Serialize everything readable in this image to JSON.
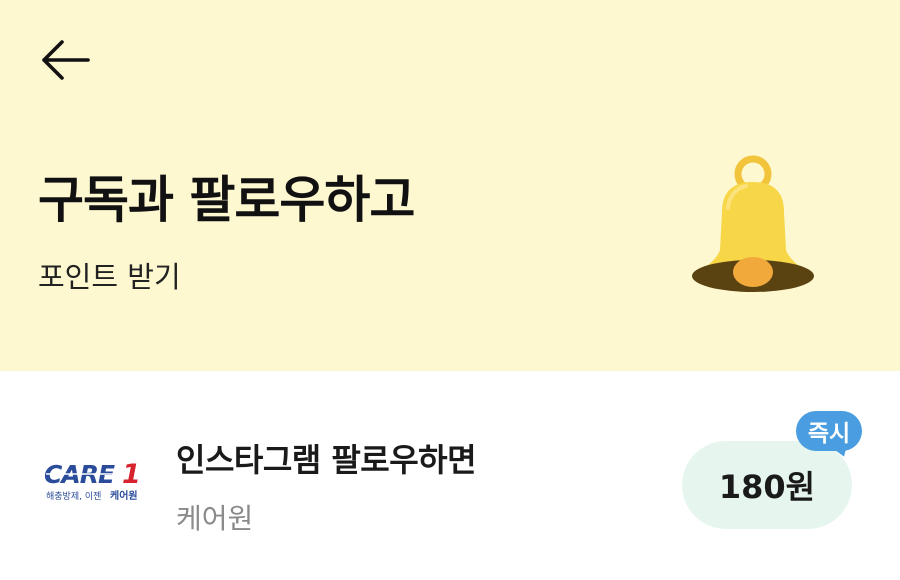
{
  "header": {
    "back_icon": "arrow-left-icon",
    "title": "구독과 팔로우하고",
    "subtitle": "포인트 받기",
    "illustration_icon": "bell-icon",
    "background_color": "#FEF8D1"
  },
  "offers": [
    {
      "logo": {
        "brand": "CARE1",
        "tagline": "해충방제, 이젠 케어원"
      },
      "title": "인스타그램 팔로우하면",
      "advertiser": "케어원",
      "reward": "180원",
      "badge": "즉시"
    }
  ],
  "colors": {
    "badge": "#4A9DE0",
    "reward_pill": "#E6F6EE",
    "bell": "#F7D648"
  }
}
